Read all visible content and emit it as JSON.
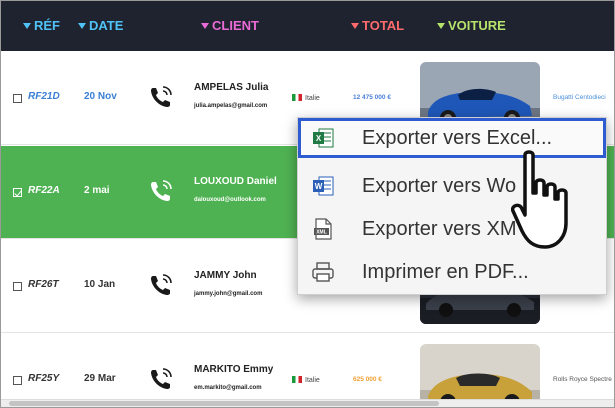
{
  "header": {
    "columns": [
      {
        "label": "RÉF",
        "color": "#4fc3f7"
      },
      {
        "label": "DATE",
        "color": "#4fc3f7"
      },
      {
        "label": "CLIENT",
        "color": "#e96bd6"
      },
      {
        "label": "TOTAL",
        "color": "#ff6b6b"
      },
      {
        "label": "VOITURE",
        "color": "#b6e36b"
      }
    ]
  },
  "rows": [
    {
      "ref": "RF21D",
      "date": "20 Nov",
      "client": "AMPELAS Julia",
      "email": "julia.ampelas@gmail.com",
      "country": "Italie",
      "total": "12 475 000 €",
      "total_color": "#4a7fd8",
      "car": "Bugatti Centodieci",
      "selected": false
    },
    {
      "ref": "RF22A",
      "date": "2 mai",
      "client": "LOUXOUD Daniel",
      "email": "dalouxoud@outlook.com",
      "selected": true
    },
    {
      "ref": "RF26T",
      "date": "10 Jan",
      "client": "JAMMY John",
      "email": "jammy.john@gmail.com",
      "selected": false
    },
    {
      "ref": "RF25Y",
      "date": "29 Mar",
      "client": "MARKITO Emmy",
      "email": "em.markito@gmail.com",
      "country": "Italie",
      "total": "625 000 €",
      "total_color": "#f0a030",
      "car": "Rolls Royce Spectre",
      "selected": false
    }
  ],
  "context_menu": {
    "items": [
      {
        "label": "Exporter vers Excel...",
        "icon": "excel-icon",
        "active": true
      },
      {
        "label": "Exporter vers Wo",
        "icon": "word-icon",
        "active": false
      },
      {
        "label": "Exporter vers XM",
        "icon": "xml-file-icon",
        "active": false
      },
      {
        "label": "Imprimer en PDF...",
        "icon": "printer-icon",
        "active": false
      }
    ]
  },
  "colors": {
    "header_bg": "#1f2330",
    "selected_row": "#4fb252",
    "menu_highlight": "#2f5bd0"
  }
}
